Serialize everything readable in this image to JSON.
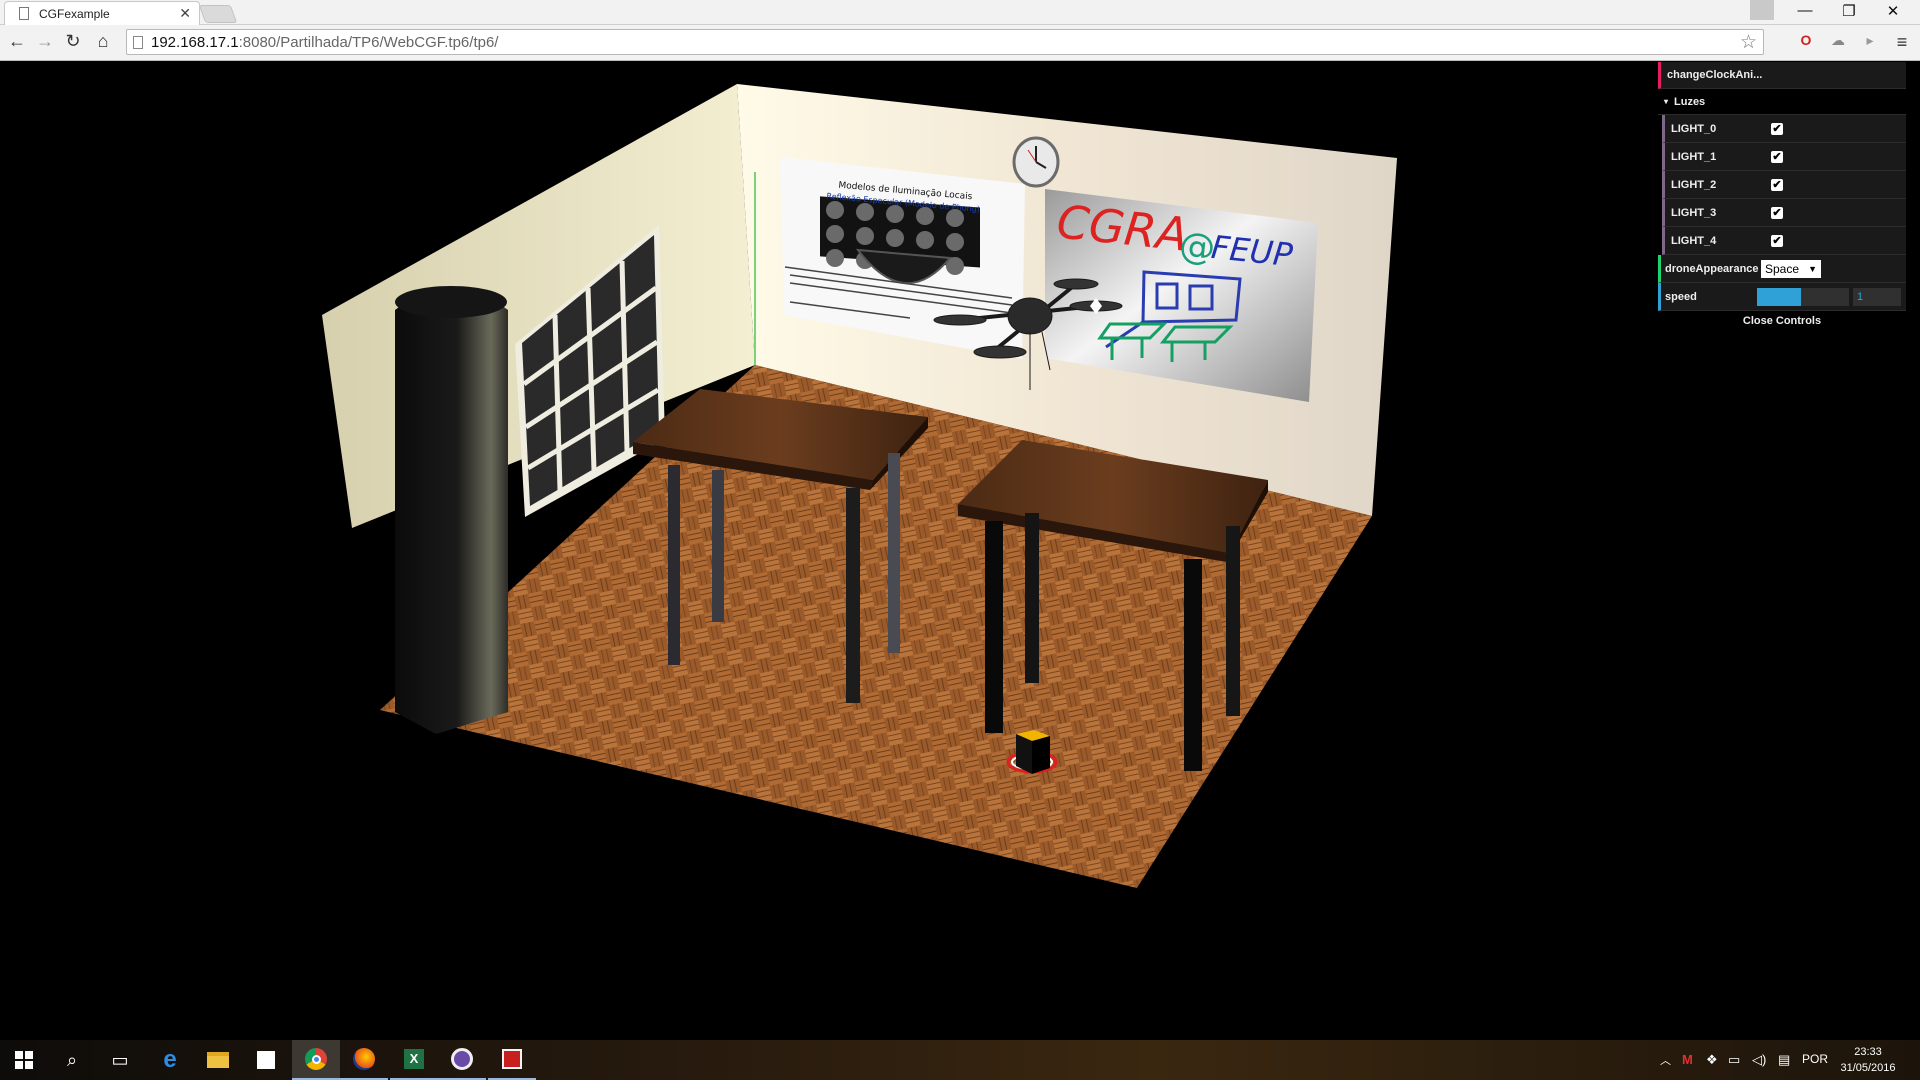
{
  "browser": {
    "tab_title": "CGFexample",
    "tab_close": "✕",
    "url_host": "192.168.17.1",
    "url_rest": ":8080/Partilhada/TP6/WebCGF.tp6/tp6/",
    "window_buttons": {
      "minimize": "—",
      "restore": "❐",
      "close": "✕"
    }
  },
  "scene": {
    "poster": {
      "title_line1": "Modelos de Iluminação Locais",
      "title_line2": "Reflexão Especular (Modelo de Phong)"
    },
    "whiteboard": {
      "text_cgra": "CGRA",
      "text_at": "@",
      "text_feup": "FEUP"
    }
  },
  "gui": {
    "change_clock_label": "changeClockAni...",
    "folder_label": "Luzes",
    "folder_arrow": "▾",
    "lights": [
      {
        "label": "LIGHT_0",
        "checked": "✔"
      },
      {
        "label": "LIGHT_1",
        "checked": "✔"
      },
      {
        "label": "LIGHT_2",
        "checked": "✔"
      },
      {
        "label": "LIGHT_3",
        "checked": "✔"
      },
      {
        "label": "LIGHT_4",
        "checked": "✔"
      }
    ],
    "drone_appearance_label": "droneAppearance",
    "drone_appearance_value": "Space",
    "speed_label": "speed",
    "speed_value": "1",
    "speed_fraction": 0.48,
    "close_controls": "Close Controls"
  },
  "taskbar": {
    "language": "POR",
    "time": "23:33",
    "date": "31/05/2016",
    "apps": [
      "start-icon",
      "search-icon",
      "task-view-icon",
      "edge-icon",
      "file-explorer-icon",
      "store-icon",
      "chrome-icon",
      "firefox-icon",
      "excel-icon",
      "app-icon",
      "acrobat-icon"
    ]
  }
}
